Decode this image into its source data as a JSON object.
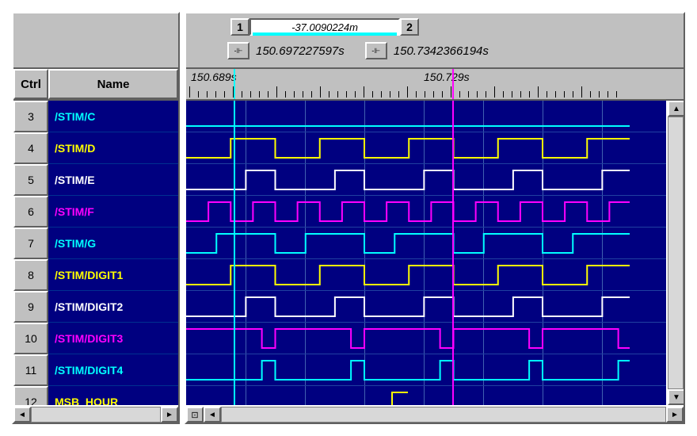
{
  "header": {
    "ctrl_label": "Ctrl",
    "name_label": "Name"
  },
  "cursor": {
    "marker1": "1",
    "marker2": "2",
    "delta": "-37.0090224m",
    "time1": "150.697227597s",
    "time2": "150.7342366194s"
  },
  "ruler": {
    "label1": "150.689s",
    "label2": "150.729s"
  },
  "signals": [
    {
      "num": "3",
      "name": "/STIM/C",
      "color": "cyan"
    },
    {
      "num": "4",
      "name": "/STIM/D",
      "color": "yellow"
    },
    {
      "num": "5",
      "name": "/STIM/E",
      "color": "white"
    },
    {
      "num": "6",
      "name": "/STIM/F",
      "color": "magenta"
    },
    {
      "num": "7",
      "name": "/STIM/G",
      "color": "cyan"
    },
    {
      "num": "8",
      "name": "/STIM/DIGIT1",
      "color": "yellow"
    },
    {
      "num": "9",
      "name": "/STIM/DIGIT2",
      "color": "white"
    },
    {
      "num": "10",
      "name": "/STIM/DIGIT3",
      "color": "magenta"
    },
    {
      "num": "11",
      "name": "/STIM/DIGIT4",
      "color": "cyan"
    },
    {
      "num": "12",
      "name": "MSB_HOUR",
      "color": "yellow"
    }
  ],
  "chart_data": {
    "type": "digital-timing",
    "time_unit": "s",
    "visible_window": {
      "start": 150.689,
      "end": 150.749
    },
    "cursors": [
      {
        "id": 1,
        "time": 150.697227597,
        "color": "#00ffff"
      },
      {
        "id": 2,
        "time": 150.7342366194,
        "color": "#ff00ff"
      }
    ],
    "delta_seconds": -0.0370090224,
    "signals": [
      {
        "name": "/STIM/C",
        "color": "#00ffff",
        "pattern": "flat-low"
      },
      {
        "name": "/STIM/D",
        "color": "#ffff00",
        "pattern": "square",
        "period_ms": 15,
        "duty": 0.5
      },
      {
        "name": "/STIM/E",
        "color": "#ffffff",
        "pattern": "square",
        "period_ms": 15,
        "duty": 0.33
      },
      {
        "name": "/STIM/F",
        "color": "#ff00ff",
        "pattern": "square",
        "period_ms": 7.5,
        "duty": 0.5
      },
      {
        "name": "/STIM/G",
        "color": "#00ffff",
        "pattern": "square",
        "period_ms": 15,
        "duty": 0.66
      },
      {
        "name": "/STIM/DIGIT1",
        "color": "#ffff00",
        "pattern": "square",
        "period_ms": 15,
        "duty": 0.5
      },
      {
        "name": "/STIM/DIGIT2",
        "color": "#ffffff",
        "pattern": "square",
        "period_ms": 15,
        "duty": 0.33
      },
      {
        "name": "/STIM/DIGIT3",
        "color": "#ff00ff",
        "pattern": "pulse",
        "period_ms": 15,
        "duty": 0.15,
        "baseline": "high"
      },
      {
        "name": "/STIM/DIGIT4",
        "color": "#00ffff",
        "pattern": "pulse",
        "period_ms": 15,
        "duty": 0.15,
        "baseline": "low"
      },
      {
        "name": "MSB_HOUR",
        "color": "#ffff00",
        "pattern": "partial"
      }
    ]
  }
}
